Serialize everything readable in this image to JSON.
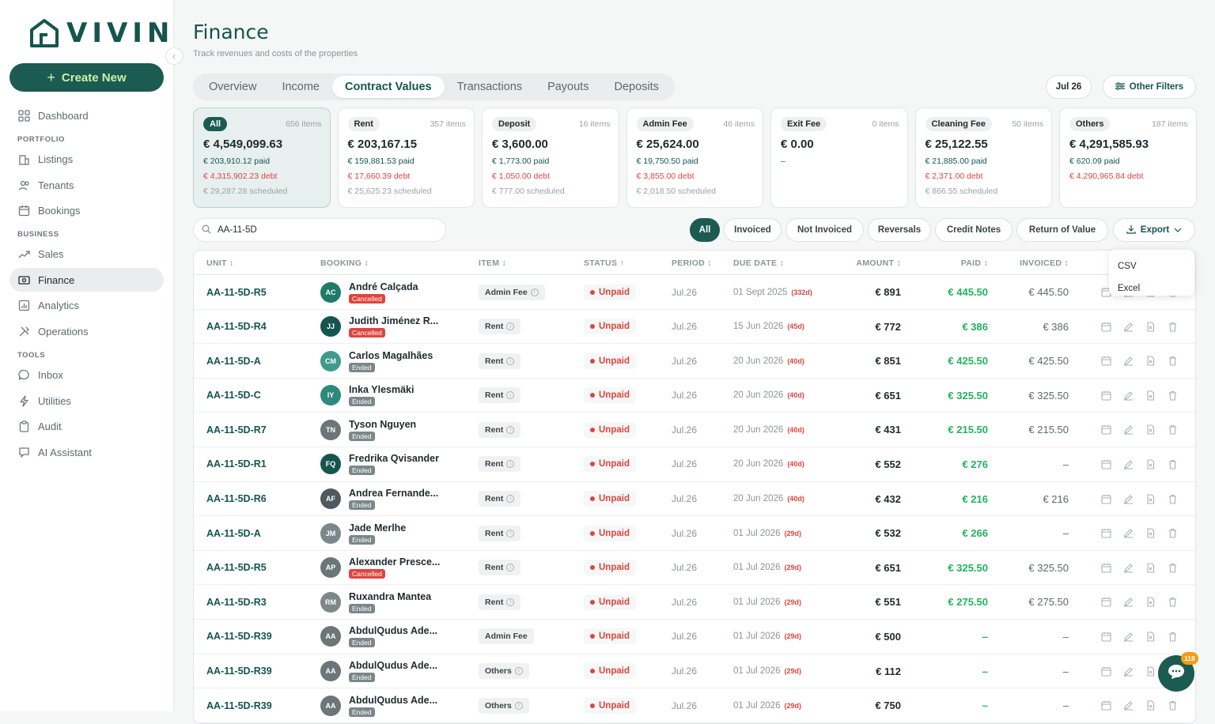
{
  "app": {
    "logo_text": "VIVIN",
    "create_label": "Create New",
    "collapse_glyph": "‹"
  },
  "sidebar": {
    "sections": {
      "portfolio": "PORTFOLIO",
      "business": "BUSINESS",
      "tools": "TOOLS"
    },
    "items": [
      {
        "label": "Dashboard",
        "icon": "grid-icon"
      },
      {
        "label": "Listings",
        "icon": "building-icon"
      },
      {
        "label": "Tenants",
        "icon": "users-icon"
      },
      {
        "label": "Bookings",
        "icon": "calendar-icon"
      },
      {
        "label": "Sales",
        "icon": "trend-icon"
      },
      {
        "label": "Finance",
        "icon": "money-icon",
        "active": true
      },
      {
        "label": "Analytics",
        "icon": "chart-icon"
      },
      {
        "label": "Operations",
        "icon": "tools-icon"
      },
      {
        "label": "Inbox",
        "icon": "chat-icon"
      },
      {
        "label": "Utilities",
        "icon": "bolt-icon"
      },
      {
        "label": "Audit",
        "icon": "clipboard-icon"
      },
      {
        "label": "AI Assistant",
        "icon": "ai-chat-icon"
      }
    ]
  },
  "header": {
    "title": "Finance",
    "subtitle": "Track revenues and costs of the properties",
    "tabs": [
      "Overview",
      "Income",
      "Contract Values",
      "Transactions",
      "Payouts",
      "Deposits"
    ],
    "active_tab": "Contract Values",
    "date_filter": "Jul 26",
    "other_filters": "Other Filters"
  },
  "cards": [
    {
      "label": "All",
      "count": "656 items",
      "amount": "€ 4,549,099.63",
      "paid": "€ 203,910.12 paid",
      "debt": "€ 4,315,902.23 debt",
      "scheduled": "€ 29,287.28 scheduled"
    },
    {
      "label": "Rent",
      "count": "357 items",
      "amount": "€ 203,167.15",
      "paid": "€ 159,881.53 paid",
      "debt": "€ 17,660.39 debt",
      "scheduled": "€ 25,625.23 scheduled"
    },
    {
      "label": "Deposit",
      "count": "16 items",
      "amount": "€ 3,600.00",
      "paid": "€ 1,773.00 paid",
      "debt": "€ 1,050.00 debt",
      "scheduled": "€ 777.00 scheduled"
    },
    {
      "label": "Admin Fee",
      "count": "46 items",
      "amount": "€ 25,624.00",
      "paid": "€ 19,750.50 paid",
      "debt": "€ 3,855.00 debt",
      "scheduled": "€ 2,018.50 scheduled"
    },
    {
      "label": "Exit Fee",
      "count": "0 items",
      "amount": "€ 0.00",
      "paid": "–",
      "debt": "",
      "scheduled": ""
    },
    {
      "label": "Cleaning Fee",
      "count": "50 items",
      "amount": "€ 25,122.55",
      "paid": "€ 21,885.00 paid",
      "debt": "€ 2,371.00 debt",
      "scheduled": "€ 866.55 scheduled"
    },
    {
      "label": "Others",
      "count": "187 items",
      "amount": "€ 4,291,585.93",
      "paid": "€ 620.09 paid",
      "debt": "€ 4,290,965.84 debt",
      "scheduled": ""
    }
  ],
  "search": {
    "value": "AA-11-5D"
  },
  "filters": [
    "All",
    "Invoiced",
    "Not Invoiced",
    "Reversals",
    "Credit Notes",
    "Return of Value"
  ],
  "export": {
    "label": "Export",
    "options": [
      "CSV",
      "Excel"
    ]
  },
  "table": {
    "headers": {
      "unit": "UNIT ↕",
      "booking": "BOOKING ↕",
      "item": "ITEM ↕",
      "status": "STATUS ↑",
      "period": "PERIOD ↕",
      "due": "DUE DATE ↕",
      "amount": "AMOUNT ↕",
      "paid": "PAID ↕",
      "invoiced": "INVOICED ↕"
    },
    "rows": [
      {
        "unit": "AA-11-5D-R5",
        "initials": "AC",
        "avatar_color": "#1f7a6a",
        "name": "André Calçada",
        "bstatus": "Cancelled",
        "item": "Admin Fee",
        "item_info": true,
        "status": "Unpaid",
        "period": "Jul.26",
        "due": "01 Sept 2025",
        "due_tag": "(332d)",
        "amount": "€ 891",
        "paid": "€ 445.50",
        "invoiced": "€ 445.50"
      },
      {
        "unit": "AA-11-5D-R4",
        "initials": "JJ",
        "avatar_color": "#14564f",
        "name": "Judith Jiménez R...",
        "bstatus": "Cancelled",
        "item": "Rent",
        "item_info": true,
        "status": "Unpaid",
        "period": "Jul.26",
        "due": "15 Jun 2026",
        "due_tag": "(45d)",
        "amount": "€ 772",
        "paid": "€ 386",
        "invoiced": "€ 386"
      },
      {
        "unit": "AA-11-5D-A",
        "initials": "CM",
        "avatar_color": "#3e9a8c",
        "name": "Carlos Magalhães",
        "bstatus": "Ended",
        "item": "Rent",
        "item_info": true,
        "status": "Unpaid",
        "period": "Jul.26",
        "due": "20 Jun 2026",
        "due_tag": "(40d)",
        "amount": "€ 851",
        "paid": "€ 425.50",
        "invoiced": "€ 425.50"
      },
      {
        "unit": "AA-11-5D-C",
        "initials": "IY",
        "avatar_color": "#2b8a7b",
        "name": "Inka Ylesmäki",
        "bstatus": "Ended",
        "item": "Rent",
        "item_info": true,
        "status": "Unpaid",
        "period": "Jul.26",
        "due": "20 Jun 2026",
        "due_tag": "(40d)",
        "amount": "€ 651",
        "paid": "€ 325.50",
        "invoiced": "€ 325.50"
      },
      {
        "unit": "AA-11-5D-R7",
        "initials": "TN",
        "avatar_color": "#6b7679",
        "name": "Tyson Nguyen",
        "bstatus": "Ended",
        "item": "Rent",
        "item_info": true,
        "status": "Unpaid",
        "period": "Jul.26",
        "due": "20 Jun 2026",
        "due_tag": "(40d)",
        "amount": "€ 431",
        "paid": "€ 215.50",
        "invoiced": "€ 215.50"
      },
      {
        "unit": "AA-11-5D-R1",
        "initials": "FQ",
        "avatar_color": "#14564f",
        "name": "Fredrika Qvisander",
        "bstatus": "Ended",
        "item": "Rent",
        "item_info": true,
        "status": "Unpaid",
        "period": "Jul.26",
        "due": "20 Jun 2026",
        "due_tag": "(40d)",
        "amount": "€ 552",
        "paid": "€ 276",
        "invoiced": "–"
      },
      {
        "unit": "AA-11-5D-R6",
        "initials": "AF",
        "avatar_color": "#4e5a5d",
        "name": "Andrea Fernande...",
        "bstatus": "Ended",
        "item": "Rent",
        "item_info": true,
        "status": "Unpaid",
        "period": "Jul.26",
        "due": "20 Jun 2026",
        "due_tag": "(40d)",
        "amount": "€ 432",
        "paid": "€ 216",
        "invoiced": "€ 216"
      },
      {
        "unit": "AA-11-5D-A",
        "initials": "JM",
        "avatar_color": "#7c878a",
        "name": "Jade Merlhe",
        "bstatus": "Ended",
        "item": "Rent",
        "item_info": true,
        "status": "Unpaid",
        "period": "Jul.26",
        "due": "01 Jul 2026",
        "due_tag": "(29d)",
        "amount": "€ 532",
        "paid": "€ 266",
        "invoiced": "–"
      },
      {
        "unit": "AA-11-5D-R5",
        "initials": "AP",
        "avatar_color": "#6b7679",
        "name": "Alexander Presce...",
        "bstatus": "Cancelled",
        "item": "Rent",
        "item_info": true,
        "status": "Unpaid",
        "period": "Jul.26",
        "due": "01 Jul 2026",
        "due_tag": "(29d)",
        "amount": "€ 651",
        "paid": "€ 325.50",
        "invoiced": "€ 325.50"
      },
      {
        "unit": "AA-11-5D-R3",
        "initials": "RM",
        "avatar_color": "#7c878a",
        "name": "Ruxandra Mantea",
        "bstatus": "Ended",
        "item": "Rent",
        "item_info": true,
        "status": "Unpaid",
        "period": "Jul.26",
        "due": "01 Jul 2026",
        "due_tag": "(29d)",
        "amount": "€ 551",
        "paid": "€ 275.50",
        "invoiced": "€ 275.50"
      },
      {
        "unit": "AA-11-5D-R39",
        "initials": "AA",
        "avatar_color": "#6b7679",
        "name": "AbdulQudus Ade...",
        "bstatus": "Ended",
        "item": "Admin Fee",
        "item_info": false,
        "status": "Unpaid",
        "period": "Jul.26",
        "due": "01 Jul 2026",
        "due_tag": "(29d)",
        "amount": "€ 500",
        "paid": "–",
        "invoiced": "–"
      },
      {
        "unit": "AA-11-5D-R39",
        "initials": "AA",
        "avatar_color": "#6b7679",
        "name": "AbdulQudus Ade...",
        "bstatus": "Ended",
        "item": "Others",
        "item_info": true,
        "status": "Unpaid",
        "period": "Jul.26",
        "due": "01 Jul 2026",
        "due_tag": "(29d)",
        "amount": "€ 112",
        "paid": "–",
        "invoiced": "–"
      },
      {
        "unit": "AA-11-5D-R39",
        "initials": "AA",
        "avatar_color": "#6b7679",
        "name": "AbdulQudus Ade...",
        "bstatus": "Ended",
        "item": "Others",
        "item_info": true,
        "status": "Unpaid",
        "period": "Jul.26",
        "due": "01 Jul 2026",
        "due_tag": "(29d)",
        "amount": "€ 750",
        "paid": "–",
        "invoiced": "–"
      }
    ]
  },
  "chat": {
    "badge": "118"
  },
  "colors": {
    "brand": "#1c5b51",
    "accent": "#c6f3a7",
    "debt": "#e0443e",
    "paid": "#22b35e",
    "cancelled": "#e0443e",
    "ended": "#7c878a"
  }
}
